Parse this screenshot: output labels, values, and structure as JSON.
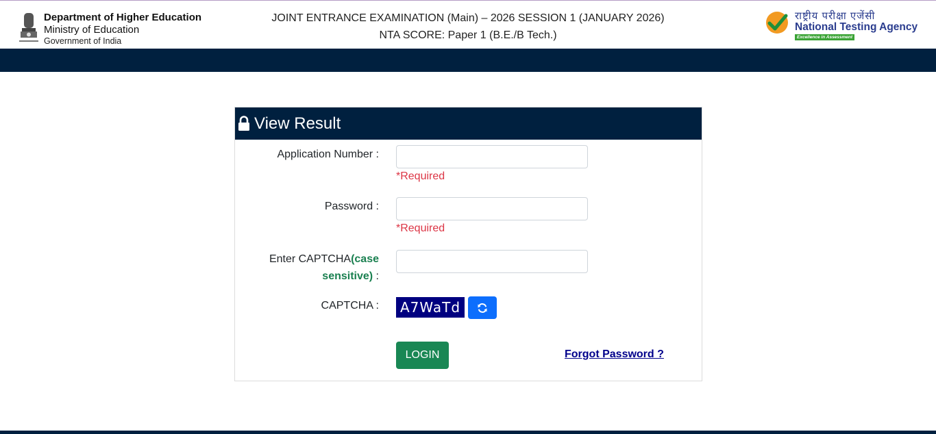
{
  "header": {
    "dept_line1": "Department of Higher Education",
    "dept_line2": "Ministry of Education",
    "dept_line3": "Government of India",
    "title_line1": "JOINT ENTRANCE EXAMINATION (Main) – 2026 SESSION 1 (JANUARY 2026)",
    "title_line2": "NTA SCORE: Paper 1 (B.E./B Tech.)",
    "nta_hindi": "राष्ट्रीय परीक्षा एजेंसी",
    "nta_english": "National Testing Agency",
    "nta_tagline": "Excellence in Assessment"
  },
  "panel": {
    "title": "View Result",
    "application_label": "Application Number :",
    "application_value": "",
    "application_required": "*Required",
    "password_label": "Password :",
    "password_value": "",
    "password_required": "*Required",
    "captcha_input_label_prefix": "Enter CAPTCHA",
    "captcha_input_label_hint": "(case sensitive)",
    "captcha_input_label_suffix": " :",
    "captcha_value": "",
    "captcha_label": "CAPTCHA :",
    "captcha_text": "A7WaTd",
    "login_label": "LOGIN",
    "forgot_label": "Forgot Password ?"
  },
  "colors": {
    "navy": "#00203f",
    "login_green": "#198754",
    "refresh_blue": "#0d6efd",
    "required_red": "#dc3545",
    "captcha_bg": "#000080"
  },
  "icons": [
    "national-emblem-icon",
    "nta-check-icon",
    "lock-icon",
    "refresh-icon"
  ]
}
